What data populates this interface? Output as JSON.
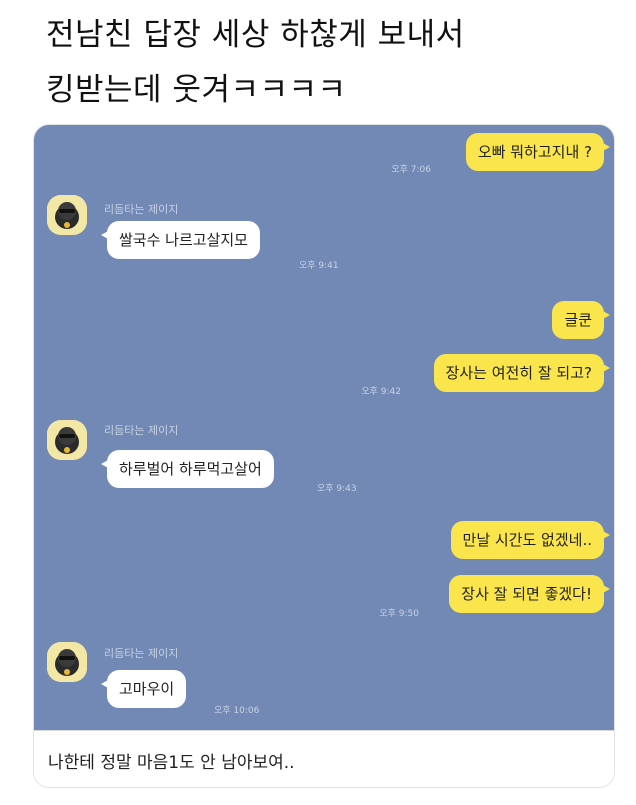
{
  "post": {
    "title_line1": "전남친 답장 세상 하찮게 보내서",
    "title_line2": "킹받는데 웃겨ㅋㅋㅋㅋ"
  },
  "chat": {
    "sender_name": "리듬타는 제이지",
    "avatar_icon": "character-avatar-icon",
    "colors": {
      "background": "#7189b4",
      "my_bubble": "#fbe54d",
      "their_bubble": "#ffffff"
    },
    "messages": [
      {
        "from": "me",
        "text": "오빠 뭐하고지내 ?",
        "time": "오후 7:06"
      },
      {
        "from": "them",
        "text": "쌀국수 나르고살지모",
        "time": "오후 9:41"
      },
      {
        "from": "me",
        "text": "글쿤",
        "time": ""
      },
      {
        "from": "me",
        "text": "장사는 여전히 잘 되고?",
        "time": "오후 9:42"
      },
      {
        "from": "them",
        "text": "하루벌어 하루먹고살어",
        "time": "오후 9:43"
      },
      {
        "from": "me",
        "text": "만날 시간도 없겠네..",
        "time": ""
      },
      {
        "from": "me",
        "text": "장사 잘 되면 좋겠다!",
        "time": "오후 9:50"
      },
      {
        "from": "them",
        "text": "고마우이",
        "time": "오후 10:06"
      }
    ]
  },
  "caption": {
    "text": "나한테 정말 마음1도 안 남아보여.."
  }
}
